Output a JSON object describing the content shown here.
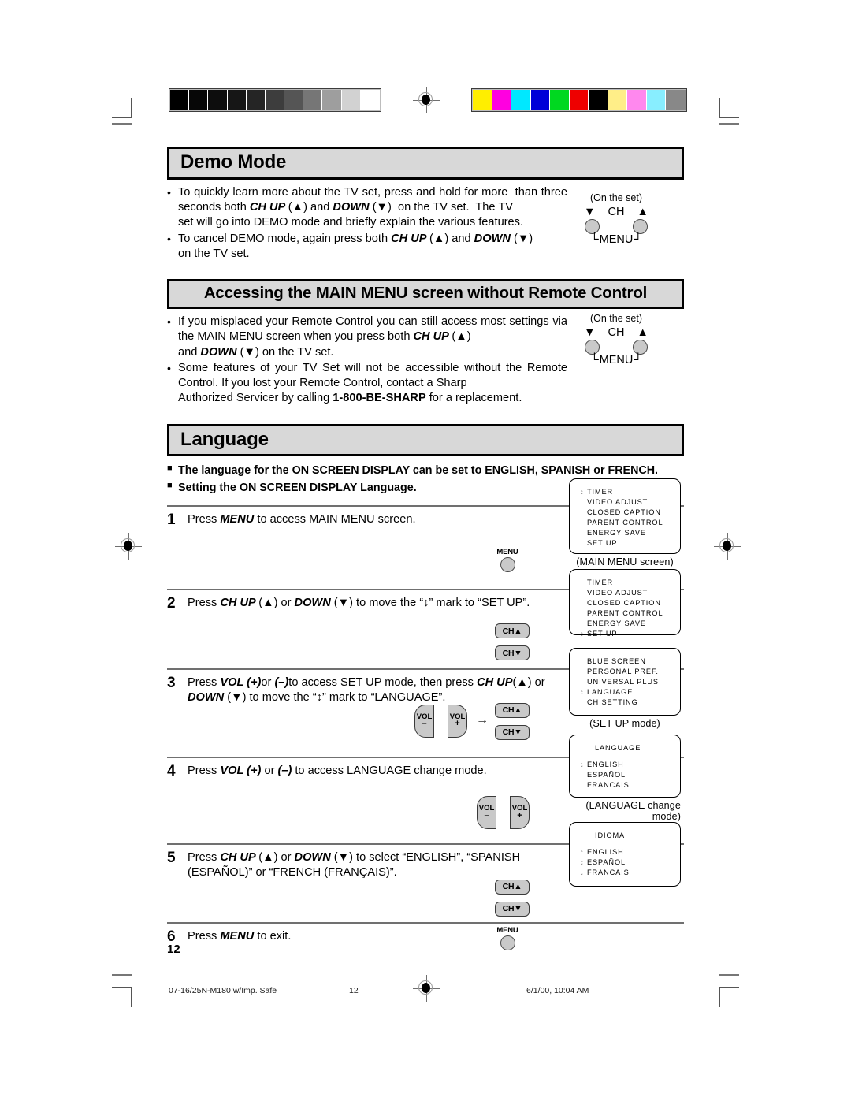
{
  "document": {
    "page_number": "12",
    "footer": {
      "file_label": "07-16/25N-M180 w/Imp. Safe",
      "page": "12",
      "timestamp": "6/1/00, 10:04 AM"
    }
  },
  "sections": [
    {
      "id": "demo-mode",
      "heading": "Demo Mode",
      "bullets": [
        "To quickly learn more about the TV set, press and hold for more  than three seconds both CH UP (▲) and DOWN (▼)  on the TV set.  The TV set will go into DEMO mode and briefly explain the various features.",
        "To cancel DEMO mode, again press both CH UP (▲) and DOWN (▼) on the TV set."
      ],
      "onset": {
        "caption": "(On the set)",
        "down_arrow": "▼",
        "ch_label": "CH",
        "up_arrow": "▲",
        "menu_label": "MENU"
      }
    },
    {
      "id": "main-menu-without-remote",
      "heading": "Accessing the MAIN MENU screen without Remote Control",
      "bullets": [
        "If you misplaced your Remote Control you can still access most settings via the MAIN MENU screen when you press both CH UP (▲) and DOWN (▼) on the TV set.",
        "Some features of your TV Set will not be accessible without the Remote Control. If you lost your Remote Control, contact a Sharp Authorized Servicer by calling 1-800-BE-SHARP for a replacement."
      ],
      "onset": {
        "caption": "(On the set)",
        "down_arrow": "▼",
        "ch_label": "CH",
        "up_arrow": "▲",
        "menu_label": "MENU"
      }
    }
  ],
  "language_section": {
    "heading": "Language",
    "notes": [
      "The language for the ON SCREEN DISPLAY can be set to ENGLISH, SPANISH or FRENCH.",
      "Setting the ON SCREEN DISPLAY Language."
    ]
  },
  "steps": [
    {
      "number": "1",
      "text_html": "Press <b class=\"i\">MENU </b>to access MAIN MENU screen.",
      "controls": {
        "menu_label": "MENU"
      },
      "osd": {
        "caption": "(MAIN MENU screen)",
        "items": [
          {
            "mark": "↕",
            "label": "TIMER"
          },
          {
            "mark": "",
            "label": "VIDEO ADJUST"
          },
          {
            "mark": "",
            "label": "CLOSED CAPTION"
          },
          {
            "mark": "",
            "label": "PARENT CONTROL"
          },
          {
            "mark": "",
            "label": "ENERGY SAVE"
          },
          {
            "mark": "",
            "label": "SET UP"
          }
        ]
      }
    },
    {
      "number": "2",
      "text_html": "Press <b class=\"i\">CH UP </b>(▲) or <b class=\"i\">DOWN </b>(▼) to move the “↕” mark to “SET UP”.",
      "controls": {
        "ch_up": "CH▲",
        "ch_down": "CH▼"
      },
      "osd": {
        "caption": "",
        "items": [
          {
            "mark": "",
            "label": "TIMER"
          },
          {
            "mark": "",
            "label": "VIDEO ADJUST"
          },
          {
            "mark": "",
            "label": "CLOSED CAPTION"
          },
          {
            "mark": "",
            "label": "PARENT CONTROL"
          },
          {
            "mark": "",
            "label": "ENERGY SAVE"
          },
          {
            "mark": "↕",
            "label": "SET UP"
          }
        ]
      }
    },
    {
      "number": "3",
      "text_html": "Press <b class=\"i\">VOL </b><b class=\"i\">(+)</b>or <b class=\"i\">(–)</b>to access SET UP mode, then press <b class=\"i\">CH UP</b>(▲) or <b class=\"i\">DOWN </b>(▼) to move the “↕” mark to “LANGUAGE”.",
      "controls": {
        "vol_label": "VOL",
        "vol_minus": "–",
        "vol_plus": "+",
        "arrow": "→",
        "ch_up": "CH▲",
        "ch_down": "CH▼"
      },
      "osd": {
        "caption": "(SET UP mode)",
        "items": [
          {
            "mark": "",
            "label": "BLUE SCREEN"
          },
          {
            "mark": "",
            "label": "PERSONAL PREF."
          },
          {
            "mark": "",
            "label": "UNIVERSAL PLUS"
          },
          {
            "mark": "↕",
            "label": "LANGUAGE"
          },
          {
            "mark": "",
            "label": "CH SETTING"
          }
        ]
      }
    },
    {
      "number": "4",
      "text_html": "Press <b class=\"i\">VOL (+) </b>or <b class=\"i\">(–) </b>to access LANGUAGE change mode.",
      "controls": {
        "vol_label": "VOL",
        "vol_minus": "–",
        "vol_plus": "+"
      },
      "osd": {
        "caption": "(LANGUAGE change mode)",
        "title": "LANGUAGE",
        "items": [
          {
            "mark": "↕",
            "label": "ENGLISH"
          },
          {
            "mark": "",
            "label": "ESPAÑOL"
          },
          {
            "mark": "",
            "label": "FRANCAIS"
          }
        ]
      }
    },
    {
      "number": "5",
      "text_html": "Press <b class=\"i\">CH UP </b>(▲) or <b class=\"i\">DOWN </b>(▼) to select “ENGLISH”, “SPANISH (ESPAÑOL)” or “FRENCH (FRANÇAIS)”.",
      "controls": {
        "ch_up": "CH▲",
        "ch_down": "CH▼"
      },
      "osd": {
        "caption": "",
        "title": "IDIOMA",
        "items": [
          {
            "mark": "↑",
            "label": "ENGLISH"
          },
          {
            "mark": "↕",
            "label": "ESPAÑOL"
          },
          {
            "mark": "↓",
            "label": "FRANCAIS"
          }
        ]
      }
    },
    {
      "number": "6",
      "text_html": "Press <b class=\"i\">MENU </b>to exit.",
      "controls": {
        "menu_label": "MENU"
      },
      "osd": null
    }
  ],
  "calibration": {
    "gray_steps": [
      "#000000",
      "#070707",
      "#0d0d0d",
      "#161616",
      "#252525",
      "#3d3d3d",
      "#555555",
      "#767676",
      "#9e9e9e",
      "#d2d2d2",
      "#ffffff"
    ],
    "color_steps": [
      "#ffee00",
      "#ff00e0",
      "#00e8ff",
      "#0000d8",
      "#00d820",
      "#ee0000",
      "#000000",
      "#ffee88",
      "#ff88ee",
      "#88eeff",
      "#888888"
    ]
  }
}
